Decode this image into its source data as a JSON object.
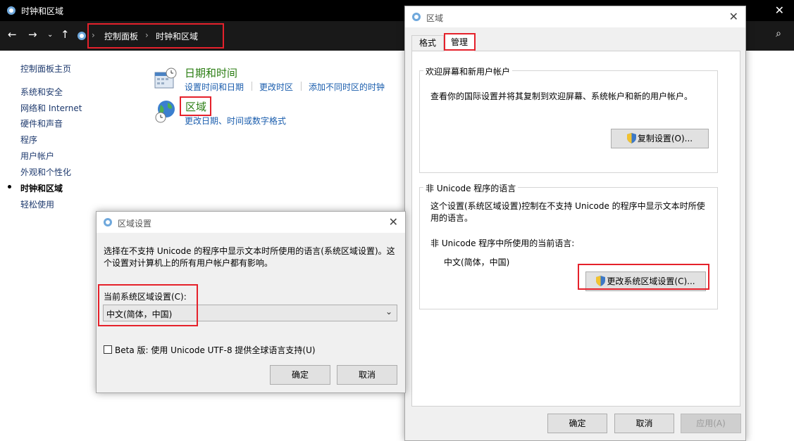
{
  "main_window": {
    "title": "时钟和区域",
    "breadcrumb": [
      "控制面板",
      "时钟和区域"
    ]
  },
  "sidebar": {
    "items": [
      {
        "label": "控制面板主页"
      },
      {
        "label": "系统和安全"
      },
      {
        "label": "网络和 Internet"
      },
      {
        "label": "硬件和声音"
      },
      {
        "label": "程序"
      },
      {
        "label": "用户帐户"
      },
      {
        "label": "外观和个性化"
      },
      {
        "label": "时钟和区域"
      },
      {
        "label": "轻松使用"
      }
    ]
  },
  "categories": {
    "datetime": {
      "title": "日期和时间",
      "links": [
        "设置时间和日期",
        "更改时区",
        "添加不同时区的时钟"
      ]
    },
    "region": {
      "title": "区域",
      "links": [
        "更改日期、时间或数字格式"
      ]
    }
  },
  "region_dialog": {
    "title": "区域",
    "tabs": [
      "格式",
      "管理"
    ],
    "welcome_group": {
      "label": "欢迎屏幕和新用户帐户",
      "description": "查看你的国际设置并将其复制到欢迎屏幕、系统帐户和新的用户帐户。",
      "copy_button": "复制设置(O)..."
    },
    "unicode_group": {
      "label": "非 Unicode 程序的语言",
      "description": "这个设置(系统区域设置)控制在不支持 Unicode 的程序中显示文本时所使用的语言。",
      "current_label": "非 Unicode 程序中所使用的当前语言:",
      "current_value": "中文(简体，中国)",
      "change_button": "更改系统区域设置(C)..."
    },
    "ok": "确定",
    "cancel": "取消",
    "apply": "应用(A)"
  },
  "locale_dialog": {
    "title": "区域设置",
    "description_line1": "选择在不支持 Unicode 的程序中显示文本时所使用的语言(系统区域设置)。这",
    "description_line2": "个设置对计算机上的所有用户帐户都有影响。",
    "current_label": "当前系统区域设置(C):",
    "selected_value": "中文(简体，中国)",
    "beta_checkbox_label": "Beta 版: 使用 Unicode UTF-8 提供全球语言支持(U)",
    "beta_checked": false,
    "ok": "确定",
    "cancel": "取消"
  },
  "colors": {
    "highlight_box": "#e5212b",
    "link": "#1a5dad",
    "category_title": "#2a7d12"
  }
}
